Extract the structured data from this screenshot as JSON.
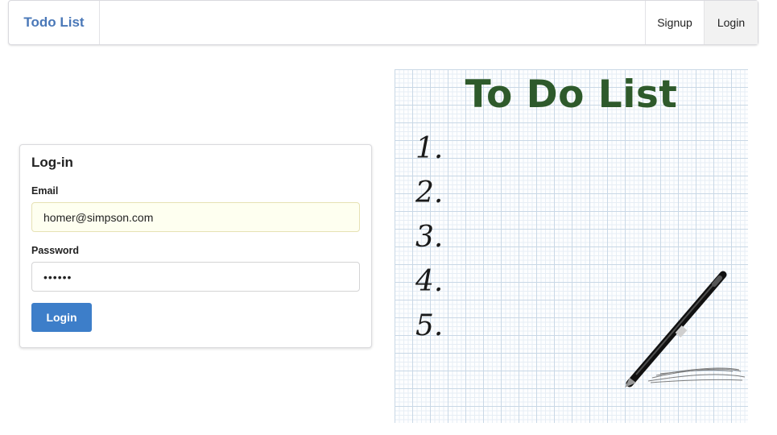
{
  "navbar": {
    "brand": "Todo List",
    "links": [
      {
        "label": "Signup"
      },
      {
        "label": "Login"
      }
    ]
  },
  "login_card": {
    "title": "Log-in",
    "email_label": "Email",
    "email_value": "homer@simpson.com",
    "password_label": "Password",
    "password_value": "123456",
    "submit_label": "Login"
  },
  "illustration": {
    "title": "To Do List",
    "items": [
      "1.",
      "2.",
      "3.",
      "4.",
      "5."
    ],
    "icon": "pen-icon"
  },
  "colors": {
    "brand": "#4a78b8",
    "button": "#3d7ec9",
    "illustration_title": "#2e5a2b"
  }
}
